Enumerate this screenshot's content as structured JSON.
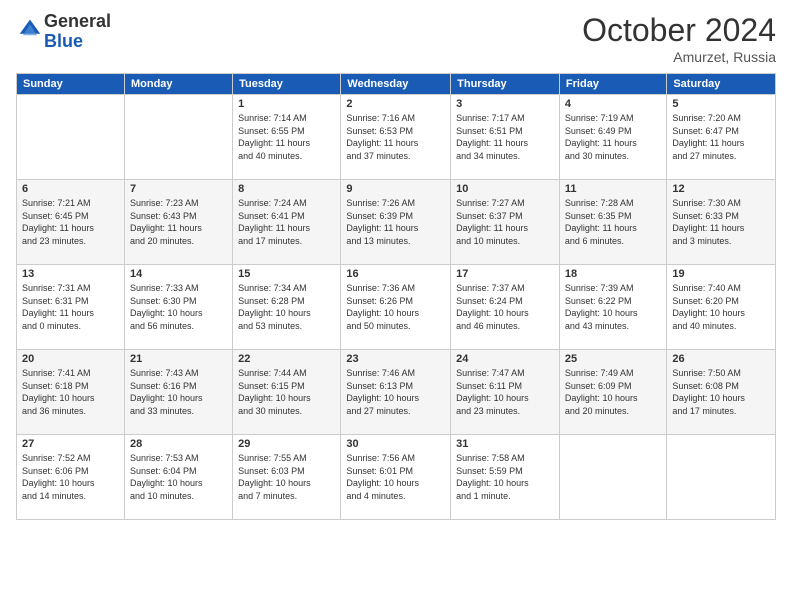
{
  "header": {
    "logo_general": "General",
    "logo_blue": "Blue",
    "month": "October 2024",
    "location": "Amurzet, Russia"
  },
  "weekdays": [
    "Sunday",
    "Monday",
    "Tuesday",
    "Wednesday",
    "Thursday",
    "Friday",
    "Saturday"
  ],
  "rows": [
    [
      {
        "day": "",
        "info": ""
      },
      {
        "day": "",
        "info": ""
      },
      {
        "day": "1",
        "info": "Sunrise: 7:14 AM\nSunset: 6:55 PM\nDaylight: 11 hours\nand 40 minutes."
      },
      {
        "day": "2",
        "info": "Sunrise: 7:16 AM\nSunset: 6:53 PM\nDaylight: 11 hours\nand 37 minutes."
      },
      {
        "day": "3",
        "info": "Sunrise: 7:17 AM\nSunset: 6:51 PM\nDaylight: 11 hours\nand 34 minutes."
      },
      {
        "day": "4",
        "info": "Sunrise: 7:19 AM\nSunset: 6:49 PM\nDaylight: 11 hours\nand 30 minutes."
      },
      {
        "day": "5",
        "info": "Sunrise: 7:20 AM\nSunset: 6:47 PM\nDaylight: 11 hours\nand 27 minutes."
      }
    ],
    [
      {
        "day": "6",
        "info": "Sunrise: 7:21 AM\nSunset: 6:45 PM\nDaylight: 11 hours\nand 23 minutes."
      },
      {
        "day": "7",
        "info": "Sunrise: 7:23 AM\nSunset: 6:43 PM\nDaylight: 11 hours\nand 20 minutes."
      },
      {
        "day": "8",
        "info": "Sunrise: 7:24 AM\nSunset: 6:41 PM\nDaylight: 11 hours\nand 17 minutes."
      },
      {
        "day": "9",
        "info": "Sunrise: 7:26 AM\nSunset: 6:39 PM\nDaylight: 11 hours\nand 13 minutes."
      },
      {
        "day": "10",
        "info": "Sunrise: 7:27 AM\nSunset: 6:37 PM\nDaylight: 11 hours\nand 10 minutes."
      },
      {
        "day": "11",
        "info": "Sunrise: 7:28 AM\nSunset: 6:35 PM\nDaylight: 11 hours\nand 6 minutes."
      },
      {
        "day": "12",
        "info": "Sunrise: 7:30 AM\nSunset: 6:33 PM\nDaylight: 11 hours\nand 3 minutes."
      }
    ],
    [
      {
        "day": "13",
        "info": "Sunrise: 7:31 AM\nSunset: 6:31 PM\nDaylight: 11 hours\nand 0 minutes."
      },
      {
        "day": "14",
        "info": "Sunrise: 7:33 AM\nSunset: 6:30 PM\nDaylight: 10 hours\nand 56 minutes."
      },
      {
        "day": "15",
        "info": "Sunrise: 7:34 AM\nSunset: 6:28 PM\nDaylight: 10 hours\nand 53 minutes."
      },
      {
        "day": "16",
        "info": "Sunrise: 7:36 AM\nSunset: 6:26 PM\nDaylight: 10 hours\nand 50 minutes."
      },
      {
        "day": "17",
        "info": "Sunrise: 7:37 AM\nSunset: 6:24 PM\nDaylight: 10 hours\nand 46 minutes."
      },
      {
        "day": "18",
        "info": "Sunrise: 7:39 AM\nSunset: 6:22 PM\nDaylight: 10 hours\nand 43 minutes."
      },
      {
        "day": "19",
        "info": "Sunrise: 7:40 AM\nSunset: 6:20 PM\nDaylight: 10 hours\nand 40 minutes."
      }
    ],
    [
      {
        "day": "20",
        "info": "Sunrise: 7:41 AM\nSunset: 6:18 PM\nDaylight: 10 hours\nand 36 minutes."
      },
      {
        "day": "21",
        "info": "Sunrise: 7:43 AM\nSunset: 6:16 PM\nDaylight: 10 hours\nand 33 minutes."
      },
      {
        "day": "22",
        "info": "Sunrise: 7:44 AM\nSunset: 6:15 PM\nDaylight: 10 hours\nand 30 minutes."
      },
      {
        "day": "23",
        "info": "Sunrise: 7:46 AM\nSunset: 6:13 PM\nDaylight: 10 hours\nand 27 minutes."
      },
      {
        "day": "24",
        "info": "Sunrise: 7:47 AM\nSunset: 6:11 PM\nDaylight: 10 hours\nand 23 minutes."
      },
      {
        "day": "25",
        "info": "Sunrise: 7:49 AM\nSunset: 6:09 PM\nDaylight: 10 hours\nand 20 minutes."
      },
      {
        "day": "26",
        "info": "Sunrise: 7:50 AM\nSunset: 6:08 PM\nDaylight: 10 hours\nand 17 minutes."
      }
    ],
    [
      {
        "day": "27",
        "info": "Sunrise: 7:52 AM\nSunset: 6:06 PM\nDaylight: 10 hours\nand 14 minutes."
      },
      {
        "day": "28",
        "info": "Sunrise: 7:53 AM\nSunset: 6:04 PM\nDaylight: 10 hours\nand 10 minutes."
      },
      {
        "day": "29",
        "info": "Sunrise: 7:55 AM\nSunset: 6:03 PM\nDaylight: 10 hours\nand 7 minutes."
      },
      {
        "day": "30",
        "info": "Sunrise: 7:56 AM\nSunset: 6:01 PM\nDaylight: 10 hours\nand 4 minutes."
      },
      {
        "day": "31",
        "info": "Sunrise: 7:58 AM\nSunset: 5:59 PM\nDaylight: 10 hours\nand 1 minute."
      },
      {
        "day": "",
        "info": ""
      },
      {
        "day": "",
        "info": ""
      }
    ]
  ]
}
